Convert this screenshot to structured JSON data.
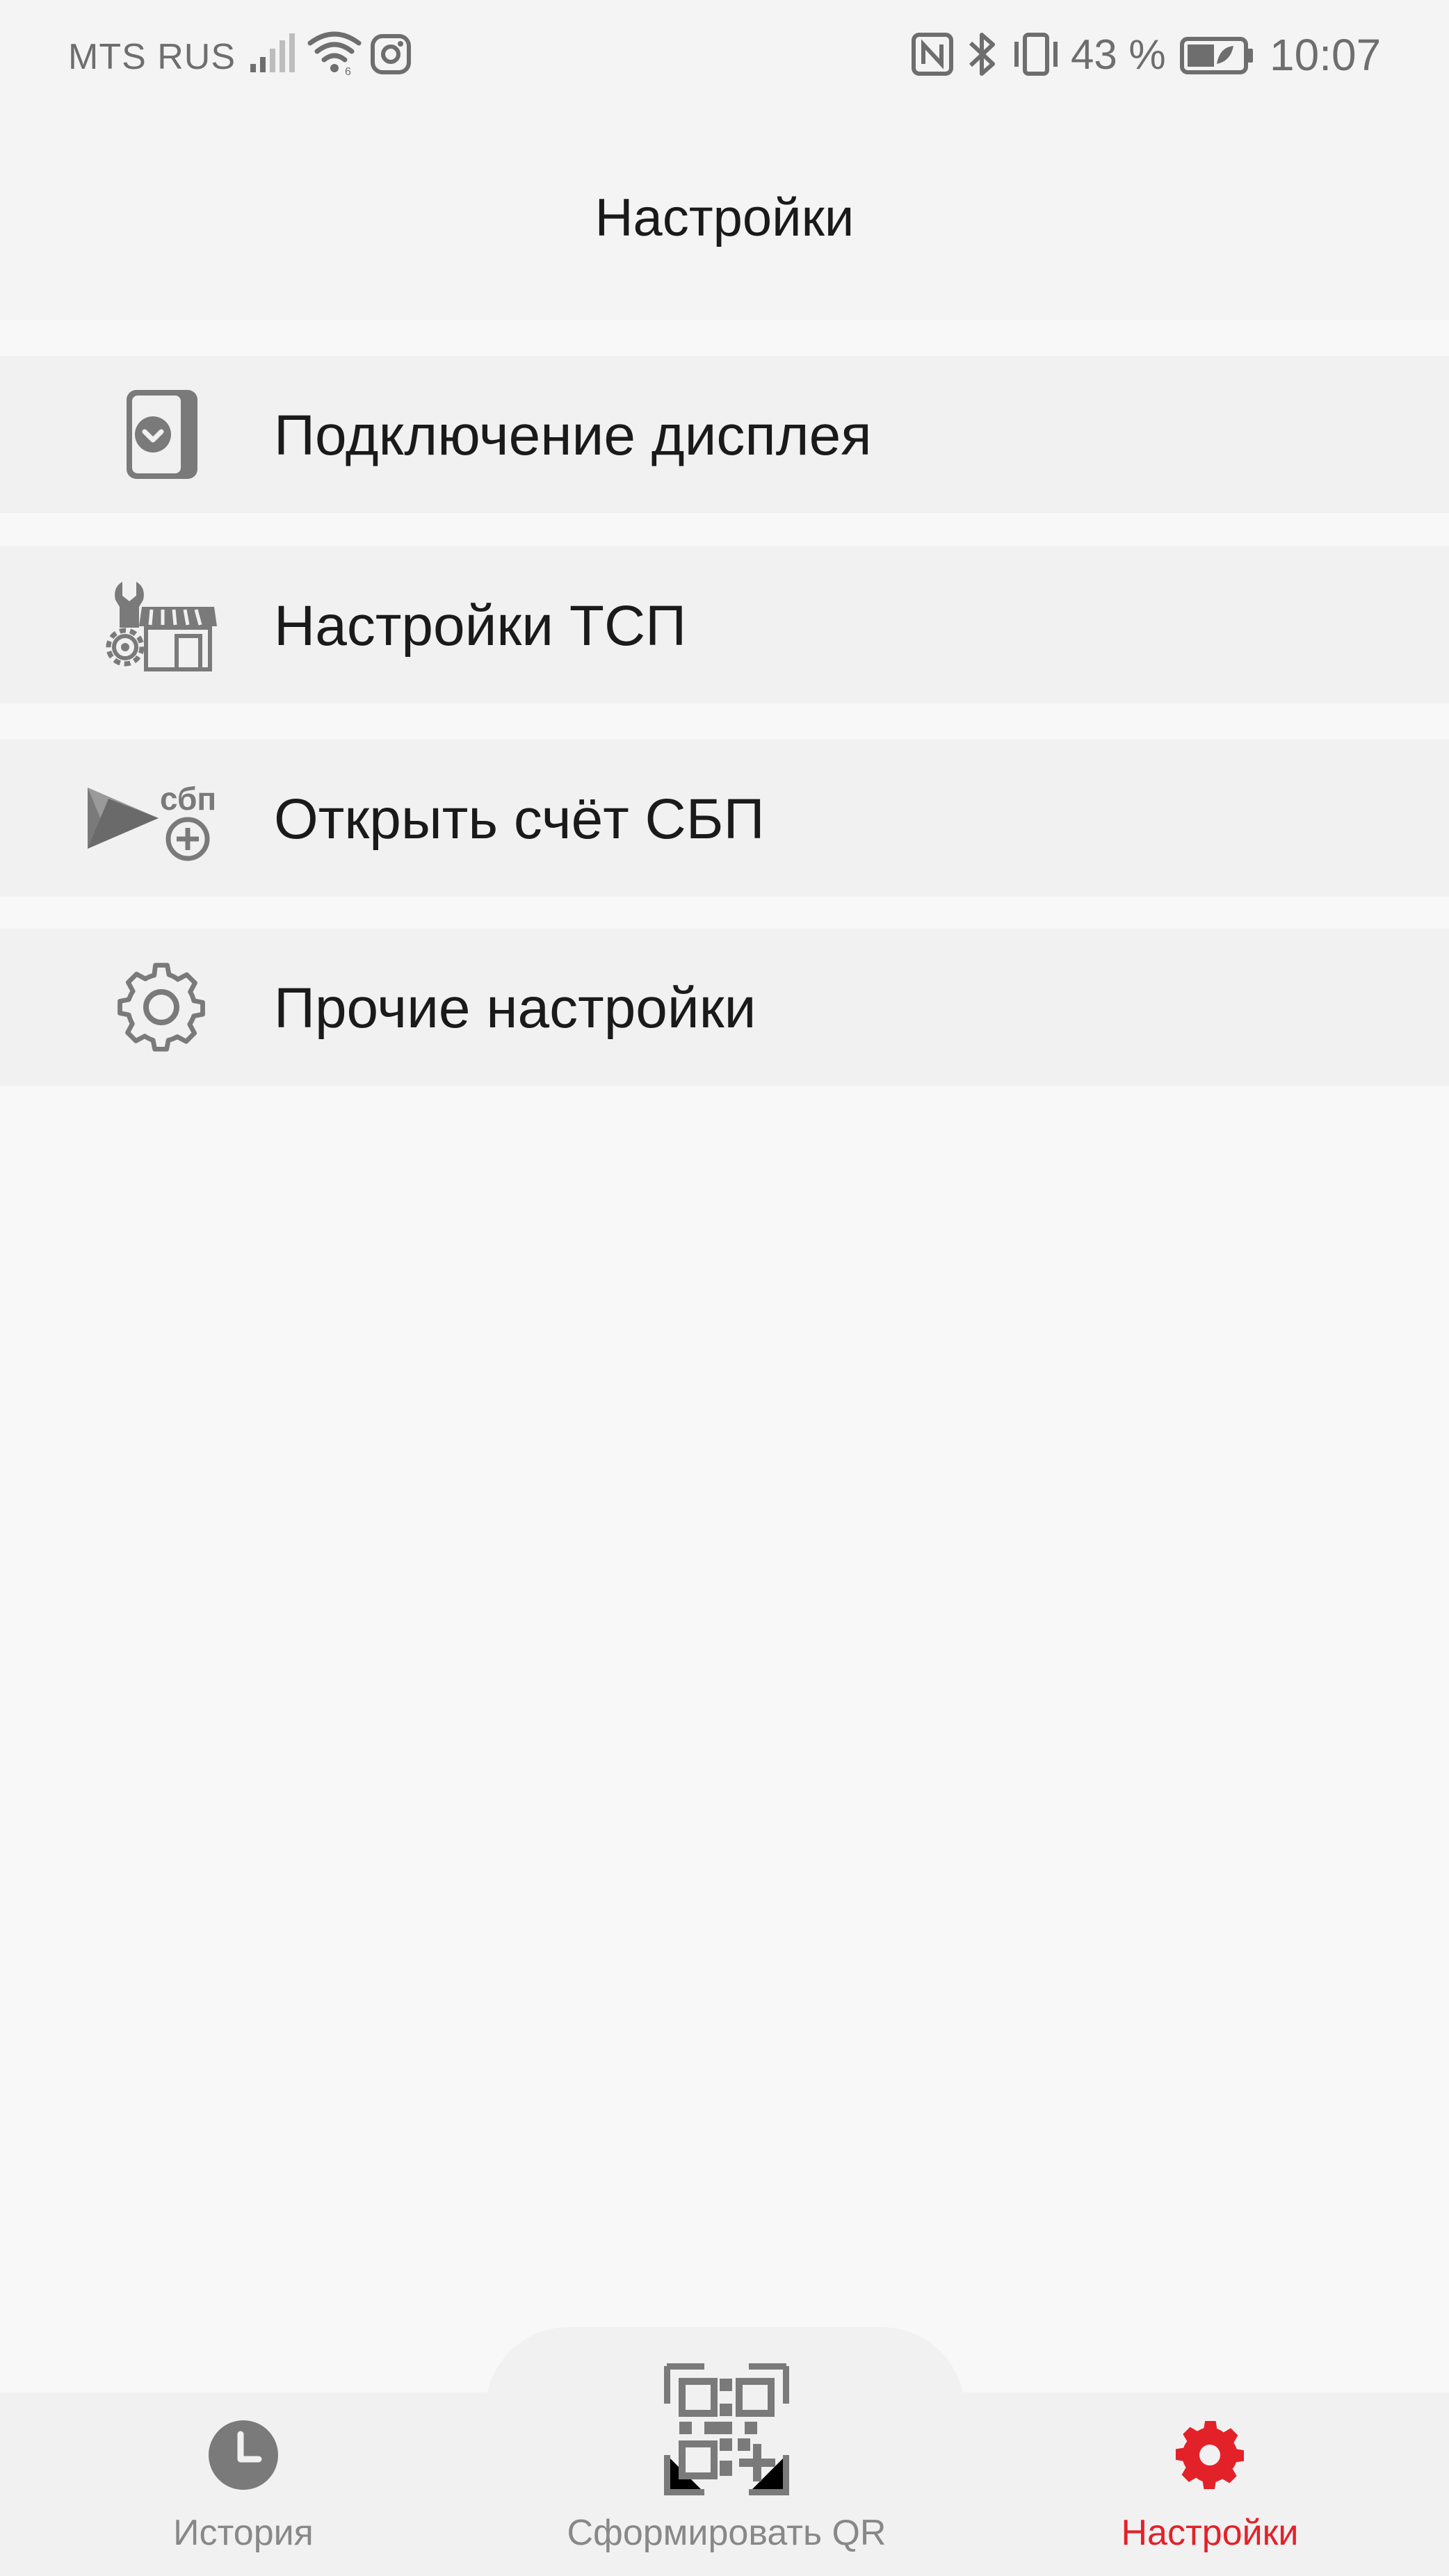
{
  "status_bar": {
    "carrier": "MTS RUS",
    "battery_percent": "43 %",
    "time": "10:07",
    "icons": [
      "signal-icon",
      "wifi-icon",
      "instagram-icon",
      "nfc-icon",
      "bluetooth-icon",
      "vibrate-icon",
      "battery-icon"
    ]
  },
  "header": {
    "title": "Настройки"
  },
  "menu": {
    "items": [
      {
        "label": "Подключение дисплея",
        "icon": "display-connect-icon"
      },
      {
        "label": "Настройки ТСП",
        "icon": "store-settings-icon"
      },
      {
        "label": "Открыть счёт СБП",
        "icon": "sbp-account-icon",
        "icon_text": "сбп"
      },
      {
        "label": "Прочие настройки",
        "icon": "gear-icon"
      }
    ]
  },
  "bottom_nav": {
    "items": [
      {
        "label": "История",
        "icon": "clock-icon",
        "active": false
      },
      {
        "label": "Сформировать QR",
        "icon": "qr-code-icon",
        "active": false
      },
      {
        "label": "Настройки",
        "icon": "gear-icon",
        "active": true
      }
    ]
  },
  "colors": {
    "accent": "#e32129",
    "icon_gray": "#7a7a7a",
    "inactive_text": "#888888",
    "background": "#f8f8f9"
  }
}
